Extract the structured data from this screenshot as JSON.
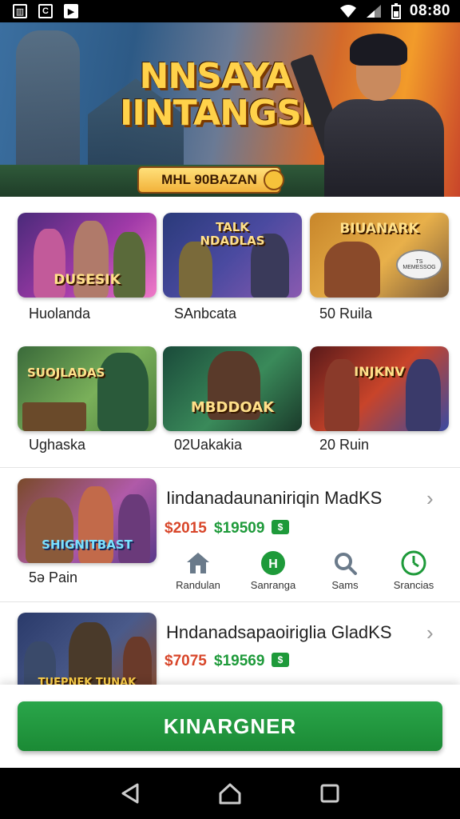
{
  "status_bar": {
    "time": "08:80"
  },
  "hero": {
    "title_line1": "NNSAYA",
    "title_line2": "IINTANGSI",
    "subtitle": "MHL 90BAZAN"
  },
  "grid": {
    "tiles": [
      {
        "art_text": "DUSESIK",
        "label": "Huolanda"
      },
      {
        "art_text": "TALK NDADLAS",
        "label": "SAnbcata"
      },
      {
        "art_text": "BIUANARK",
        "badge": "TS MEMESSOG",
        "label": "50 Ruila"
      },
      {
        "art_text": "SUOJLADAS",
        "label": "Ughaska"
      },
      {
        "art_text": "MBDDOAK",
        "label": "02Uakakia"
      },
      {
        "art_text": "INJKNV",
        "label": "20 Ruin"
      }
    ]
  },
  "rows": [
    {
      "thumb_text": "SHIGNITBAST",
      "title": "Iindanadaunaniriqin MadKS",
      "price_old": "$2015",
      "price_new": "$19509",
      "sub": "5ə Pain",
      "actions": [
        {
          "icon": "home-icon",
          "label": "Randulan"
        },
        {
          "icon": "h-badge-icon",
          "label": "Sanranga"
        },
        {
          "icon": "search-icon",
          "label": "Sams"
        },
        {
          "icon": "timer-icon",
          "label": "Srancias"
        }
      ]
    },
    {
      "thumb_text": "TUEPNEK TUNAK",
      "title": "Hndanadsapaoiriglia GladKS",
      "price_old": "$7075",
      "price_new": "$19569"
    }
  ],
  "cta": {
    "label": "KINARGNER"
  },
  "colors": {
    "accent_green": "#1e9a3a",
    "price_red": "#d8462a"
  }
}
